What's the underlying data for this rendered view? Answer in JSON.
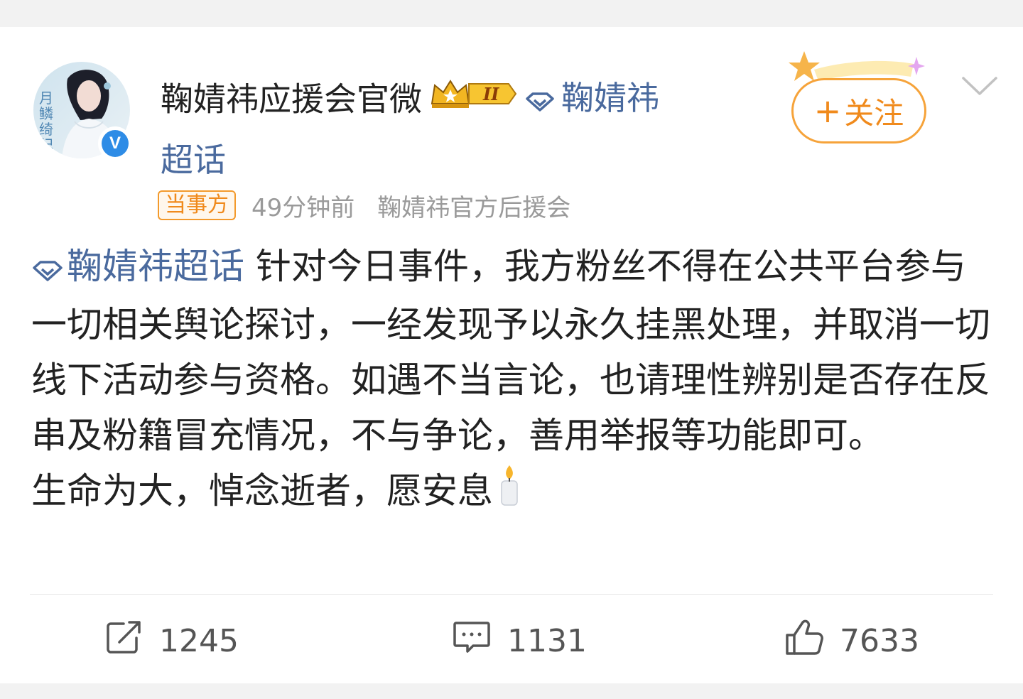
{
  "post": {
    "author": {
      "name": "鞠婧祎应援会官微",
      "crown_level": "II",
      "topic": "鞠婧祎",
      "topic_suffix": "超话",
      "avatar_caption": "月鳞绮纪",
      "verified_mark": "V"
    },
    "follow_label": "关注",
    "follow_plus": "+",
    "badge": "当事方",
    "time": "49分钟前",
    "source": "鞠婧祎官方后援会",
    "body_topic": "鞠婧祎超话",
    "body_text": " 针对今日事件，我方粉丝不得在公共平台参与一切相关舆论探讨，一经发现予以永久挂黑处理，并取消一切线下活动参与资格。如遇不当言论，也请理性辨别是否存在反串及粉籍冒充情况，不与争论，善用举报等功能即可。",
    "body_text_2": "生命为大，悼念逝者，愿安息"
  },
  "actions": {
    "repost_count": "1245",
    "comment_count": "1131",
    "like_count": "7633"
  },
  "icons": {
    "verified": "verified-badge-icon",
    "crown": "crown-icon",
    "diamond": "super-topic-diamond-icon",
    "candle": "candle-emoji-icon",
    "chevron": "chevron-down-icon",
    "repost": "repost-icon",
    "comment": "comment-icon",
    "like": "thumbs-up-icon"
  },
  "colors": {
    "accent_orange": "#f08a1c",
    "topic_blue": "#4a6a9e",
    "verified_blue": "#2e8ce6"
  }
}
